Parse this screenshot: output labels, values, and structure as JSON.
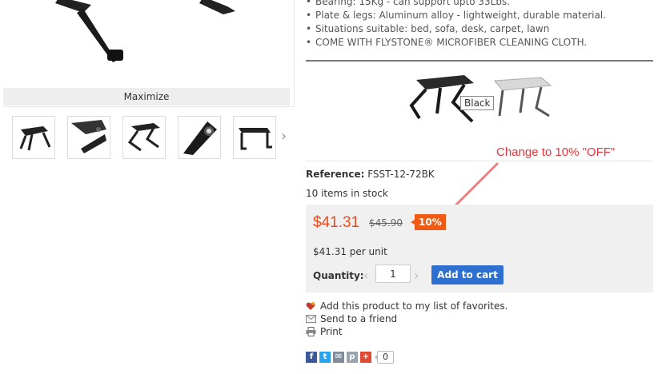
{
  "gallery": {
    "maximize_label": "Maximize",
    "thumbnails": [
      "table-flat",
      "table-folded",
      "table-angled",
      "table-detail",
      "table-side"
    ],
    "next_icon": "chevron-right-icon"
  },
  "features": [
    "Bearing: 15Kg - can support upto 33Lbs.",
    "Plate & legs: Aluminum alloy - lightweight, durable material.",
    "Situations suitable: bed, sofa, desk, carpet, lawn",
    "COME WITH FLYSTONE® MICROFIBER CLEANING CLOTH."
  ],
  "variants": {
    "tooltip": "Black",
    "options": [
      "Black",
      "Silver"
    ]
  },
  "annotation": {
    "text": "Change to 10% \"OFF\"",
    "color": "#e8343c"
  },
  "product": {
    "reference_label": "Reference:",
    "reference_value": "FSST-12-72BK",
    "stock_text": "10 items in stock",
    "price_current": "$41.31",
    "price_old": "$45.90",
    "discount": "10%",
    "per_unit": "$41.31 per unit",
    "quantity_label": "Quantity:",
    "quantity_value": "1",
    "add_to_cart_label": "Add to cart",
    "accent_color": "#ea4b1e",
    "button_color": "#2f6fd0"
  },
  "actions": {
    "favorites": "Add this product to my list of favorites.",
    "send_friend": "Send to a friend",
    "print": "Print"
  },
  "social": {
    "count": "0",
    "icons": [
      "facebook-icon",
      "twitter-icon",
      "email-icon",
      "pinterest-icon",
      "google-plus-icon"
    ]
  }
}
